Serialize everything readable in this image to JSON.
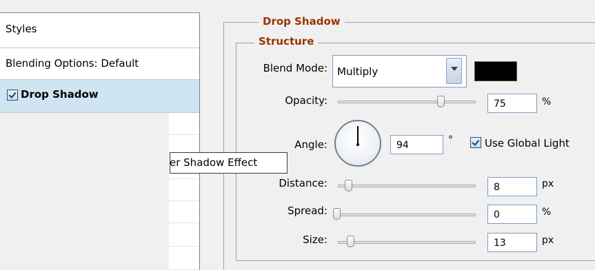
{
  "styles_list": {
    "header": "Styles",
    "blending_options": "Blending Options: Default",
    "drop_shadow": "Drop Shadow",
    "drop_shadow_checked": true
  },
  "tooltip": {
    "text": "er Shadow Effect"
  },
  "panel": {
    "section_title": "Drop Shadow",
    "group_title": "Structure",
    "blend_mode": {
      "label": "Blend Mode:",
      "value": "Multiply",
      "color": "#000000"
    },
    "opacity": {
      "label": "Opacity:",
      "value": "75",
      "unit": "%",
      "level_percent": 75
    },
    "angle": {
      "label": "Angle:",
      "value": "94",
      "unit": "°",
      "use_global_light_label": "Use Global Light",
      "use_global_light_checked": true
    },
    "distance": {
      "label": "Distance:",
      "value": "8",
      "unit": "px"
    },
    "spread": {
      "label": "Spread:",
      "value": "0",
      "unit": "%"
    },
    "size": {
      "label": "Size:",
      "value": "13",
      "unit": "px"
    }
  }
}
